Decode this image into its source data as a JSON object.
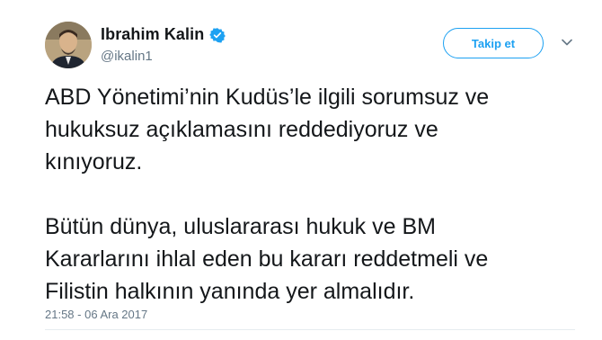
{
  "author": {
    "display_name": "Ibrahim Kalin",
    "handle": "@ikalin1",
    "verified": true,
    "avatar_icon": "profile-photo"
  },
  "actions": {
    "follow_label": "Takip et",
    "menu_icon": "chevron-down-icon"
  },
  "tweet": {
    "paragraph_1": [
      "ABD Yönetimi’nin Kudüs’le ilgili sorumsuz ve",
      "hukuksuz açıklamasını reddediyoruz ve",
      "kınıyoruz."
    ],
    "paragraph_2": [
      "Bütün dünya, uluslararası hukuk ve BM",
      "Kararlarını ihlal eden bu kararı reddetmeli ve",
      "Filistin halkının yanında yer almalıdır."
    ],
    "timestamp": "21:58 - 06 Ara 2017"
  },
  "colors": {
    "accent": "#1da1f2",
    "text": "#14171a",
    "secondary_text": "#657786"
  }
}
